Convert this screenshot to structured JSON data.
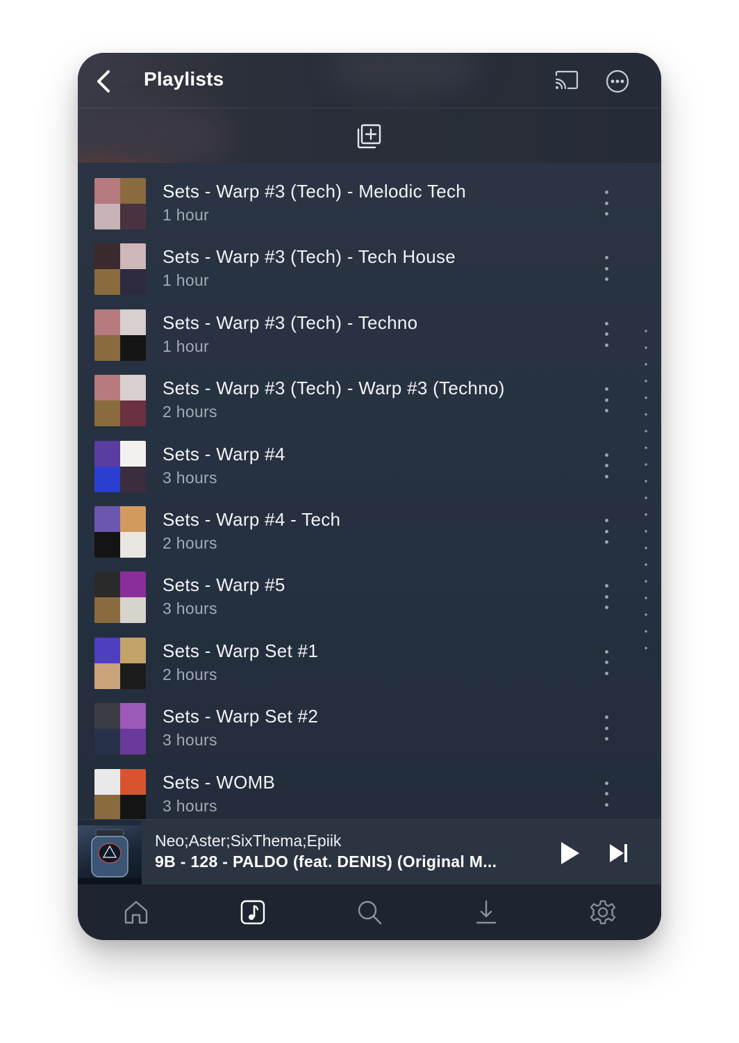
{
  "header": {
    "title": "Playlists",
    "back_icon": "chevron-left-icon",
    "cast_icon": "cast-icon",
    "more_icon": "more-horizontal-icon",
    "add_icon": "add-to-playlist-icon"
  },
  "playlists": [
    {
      "title": "Sets - Warp #3 (Tech) - Melodic Tech",
      "duration": "1 hour",
      "colors": [
        "#b77a7e",
        "#8a6b3e",
        "#c7b3b6",
        "#4a3340"
      ]
    },
    {
      "title": "Sets - Warp #3 (Tech) - Tech House",
      "duration": "1 hour",
      "colors": [
        "#3a2a2e",
        "#cdb7b9",
        "#8a6b3e",
        "#2d2a40"
      ]
    },
    {
      "title": "Sets - Warp #3 (Tech) - Techno",
      "duration": "1 hour",
      "colors": [
        "#b77a7e",
        "#d8cfcf",
        "#8a6b3e",
        "#151515"
      ]
    },
    {
      "title": "Sets - Warp #3 (Tech) - Warp #3 (Techno)",
      "duration": "2 hours",
      "colors": [
        "#b77a7e",
        "#d8cfcf",
        "#8a6b3e",
        "#6a3140"
      ]
    },
    {
      "title": "Sets - Warp #4",
      "duration": "3 hours",
      "colors": [
        "#5a3da0",
        "#f3f1ee",
        "#2a3fd0",
        "#3b2d3d"
      ]
    },
    {
      "title": "Sets - Warp #4 - Tech",
      "duration": "2 hours",
      "colors": [
        "#6d56b0",
        "#d39a5e",
        "#141414",
        "#e8e6df"
      ]
    },
    {
      "title": "Sets - Warp #5",
      "duration": "3 hours",
      "colors": [
        "#2a2a2a",
        "#8a2e9a",
        "#8a6b3e",
        "#d7d3cd"
      ]
    },
    {
      "title": "Sets - Warp Set #1",
      "duration": "2 hours",
      "colors": [
        "#4d3fc0",
        "#c4a36b",
        "#caa37a",
        "#1c1c1c"
      ]
    },
    {
      "title": "Sets - Warp Set #2",
      "duration": "3 hours",
      "colors": [
        "#3c3c44",
        "#9c5ab8",
        "#27324a",
        "#6a3a9a"
      ]
    },
    {
      "title": "Sets - WOMB",
      "duration": "3 hours",
      "colors": [
        "#e9e9e9",
        "#d8542e",
        "#8a6b3e",
        "#141414"
      ]
    }
  ],
  "now_playing": {
    "artist": "Neo;Aster;SixThema;Epiik",
    "track": "9B - 128 - PALDO (feat. DENIS) (Original M...",
    "play_icon": "play-icon",
    "next_icon": "skip-next-icon"
  },
  "tabs": [
    {
      "name": "tab-home",
      "icon": "home-icon",
      "active": false
    },
    {
      "name": "tab-music",
      "icon": "music-note-icon",
      "active": true
    },
    {
      "name": "tab-search",
      "icon": "search-icon",
      "active": false
    },
    {
      "name": "tab-downloads",
      "icon": "download-icon",
      "active": false
    },
    {
      "name": "tab-settings",
      "icon": "gear-icon",
      "active": false
    }
  ],
  "colors": {
    "background": "#273140",
    "text_primary": "#f2f4f7",
    "text_secondary": "#a2abb8",
    "icon_inactive": "#8a929e",
    "icon_active": "#ffffff"
  }
}
